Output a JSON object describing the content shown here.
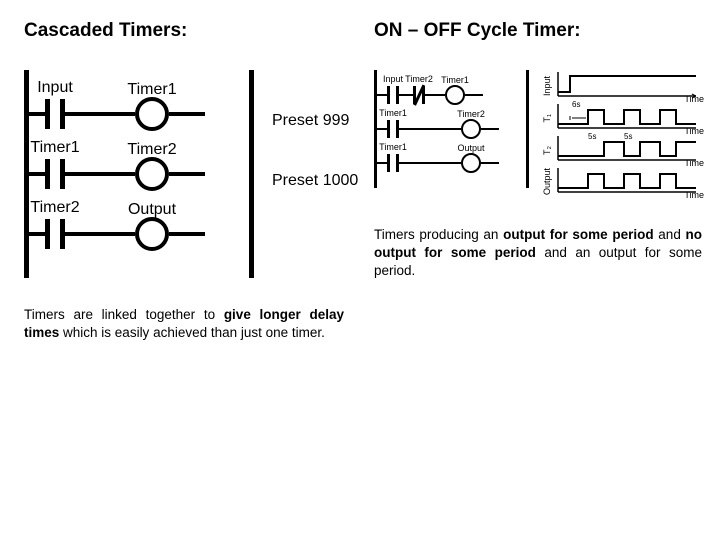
{
  "left": {
    "heading": "Cascaded Timers:",
    "ladder": {
      "rungs": [
        {
          "contact": "Input",
          "coil": "Timer1",
          "preset": "Preset 999"
        },
        {
          "contact": "Timer1",
          "coil": "Timer2",
          "preset": "Preset 1000"
        },
        {
          "contact": "Timer2",
          "coil": "Output",
          "preset": ""
        }
      ]
    },
    "caption_parts": {
      "a": "Timers are linked together to ",
      "b": "give longer delay times",
      "c": " which is easily achieved than just one timer."
    }
  },
  "right": {
    "heading": "ON – OFF Cycle Timer:",
    "ladder": {
      "rungs": [
        {
          "contacts": [
            "Input",
            "Timer2"
          ],
          "nc": [
            false,
            true
          ],
          "coil": "Timer1"
        },
        {
          "contacts": [
            "Timer1"
          ],
          "nc": [
            false
          ],
          "coil": "Timer2"
        },
        {
          "contacts": [
            "Timer1"
          ],
          "nc": [
            false
          ],
          "coil": "Output"
        }
      ]
    },
    "timing": {
      "rows": [
        {
          "label": "Input",
          "xlabel": "Time",
          "note": ""
        },
        {
          "label": "T₁",
          "xlabel": "Time",
          "note": "6s"
        },
        {
          "label": "T₂",
          "xlabel": "Time",
          "note": "5s",
          "note2": "5s"
        },
        {
          "label": "Output",
          "xlabel": "Time",
          "note": ""
        }
      ]
    },
    "caption_parts": {
      "a": "Timers producing an ",
      "b": "output for some period",
      "c": " and ",
      "d": "no output for some period",
      "e": " and an output for some period."
    }
  }
}
